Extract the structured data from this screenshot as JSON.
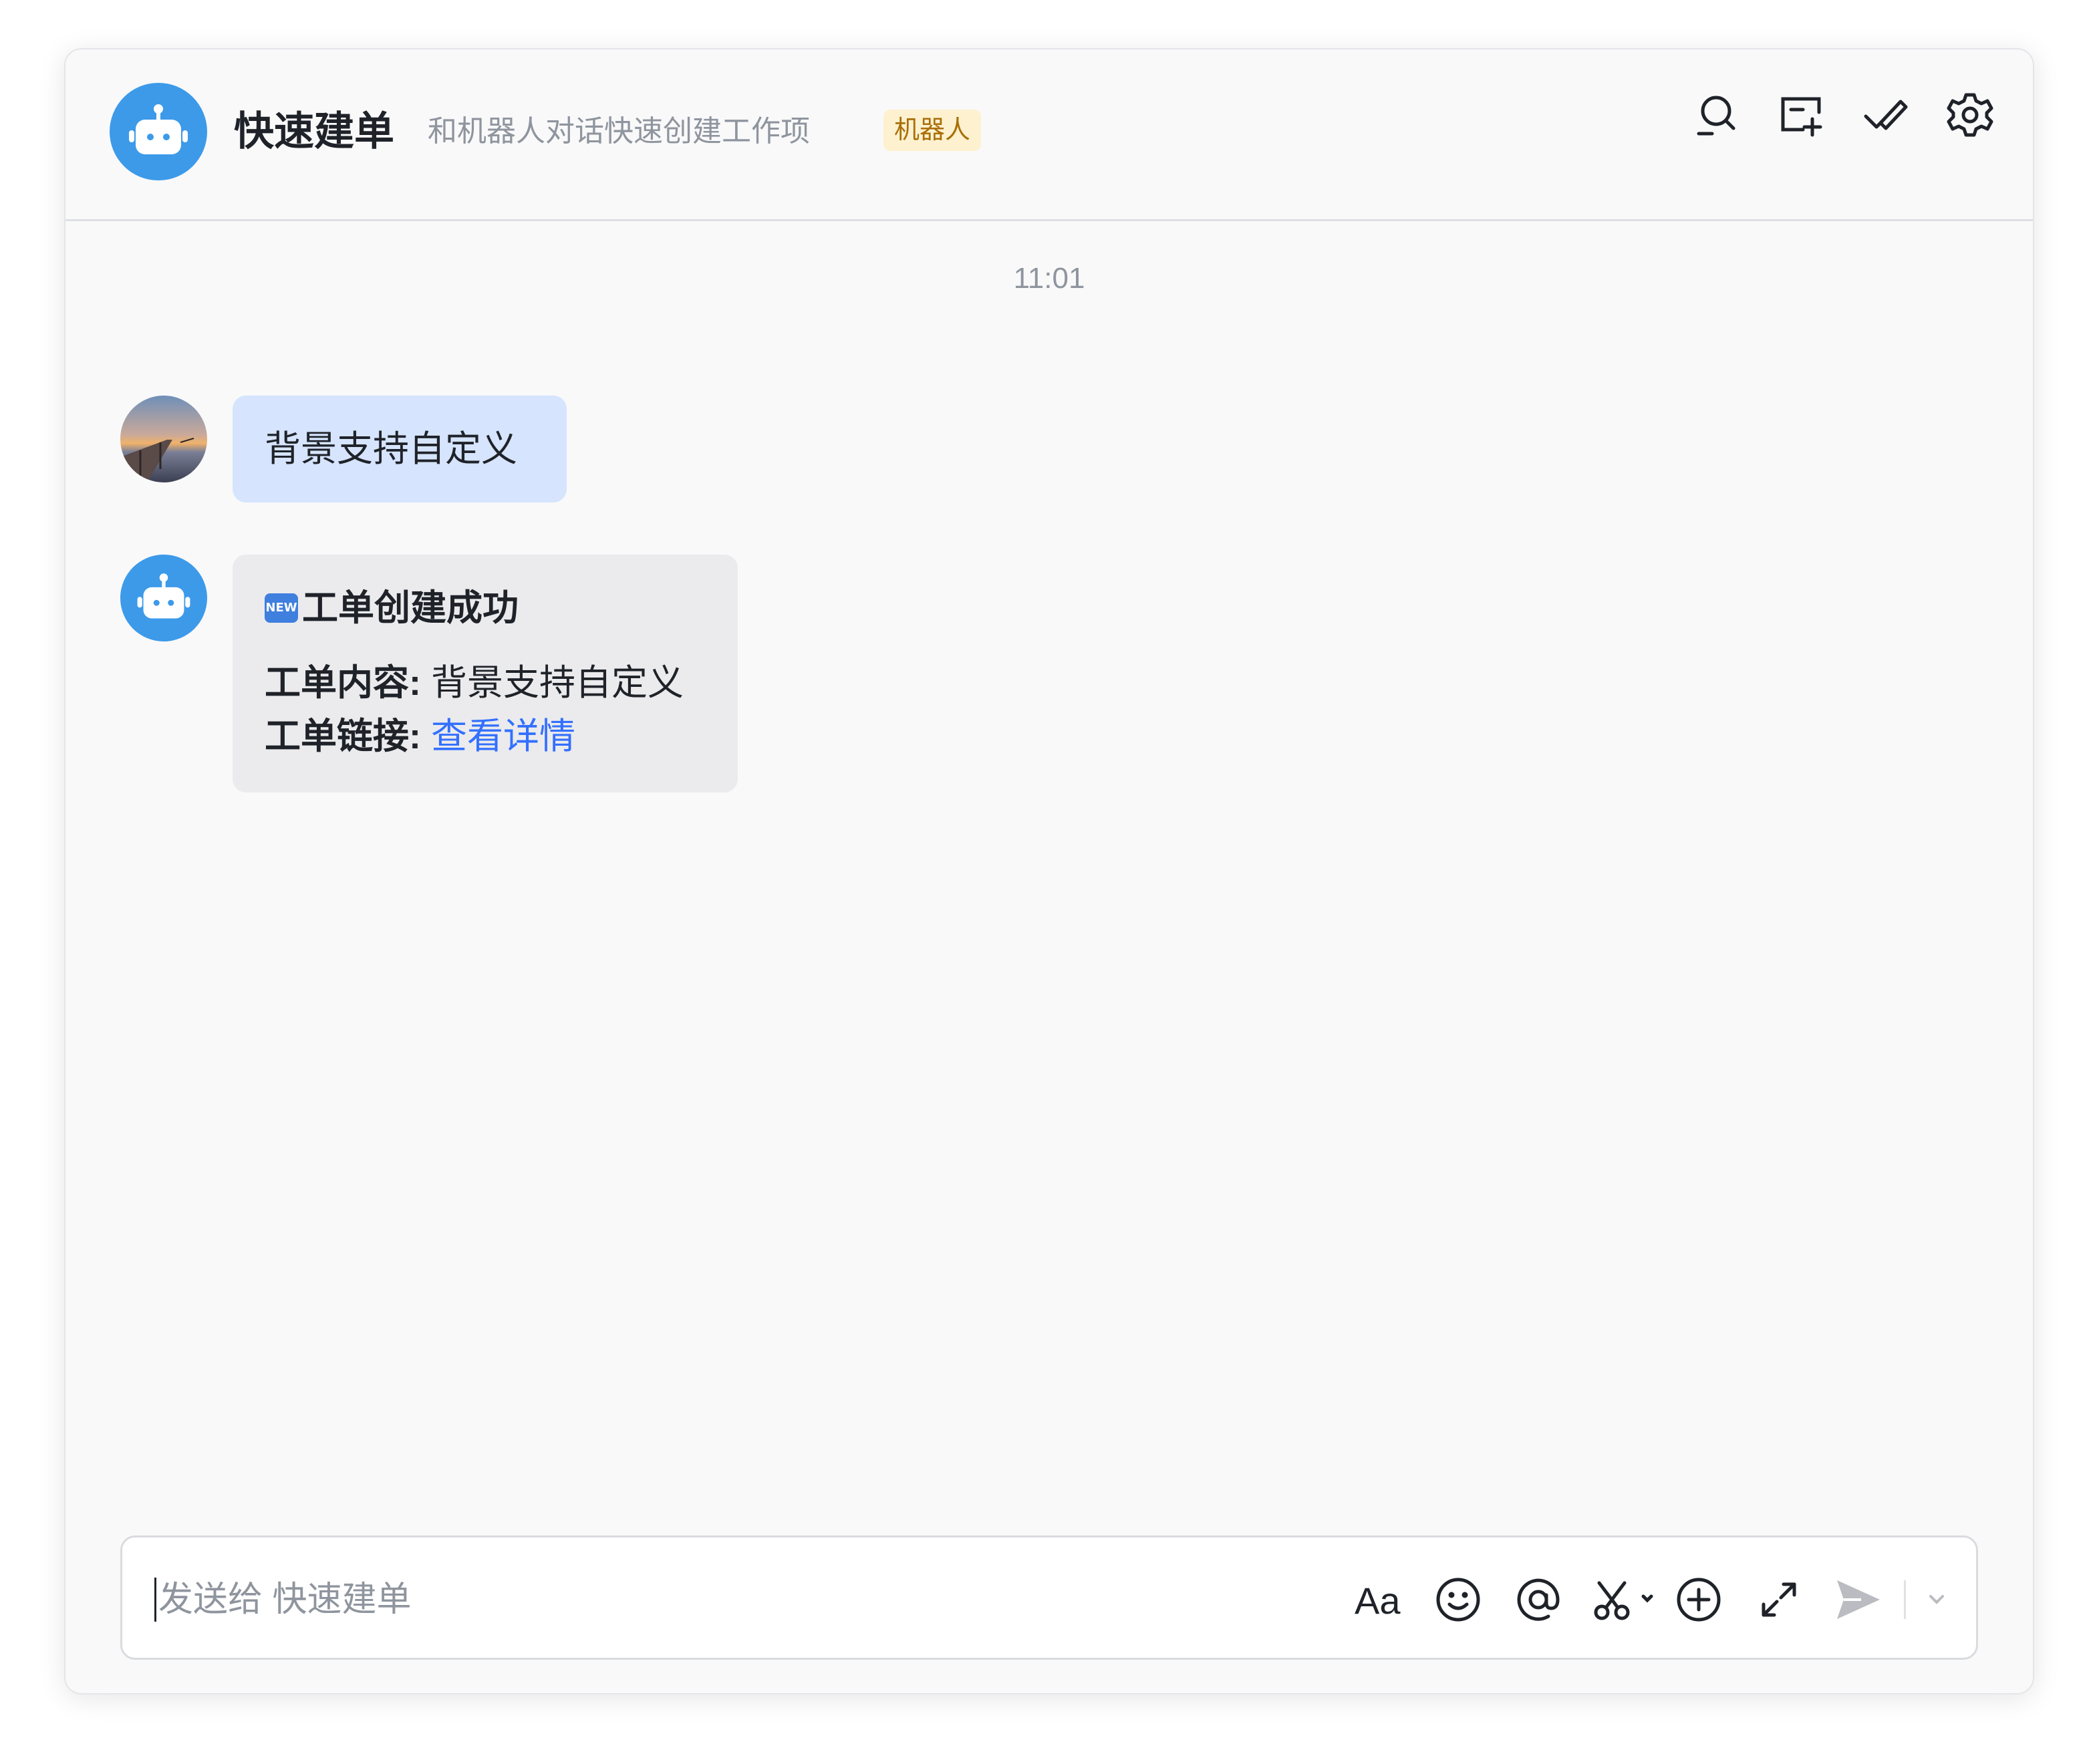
{
  "header": {
    "title": "快速建单",
    "subtitle": "和机器人对话快速创建工作项",
    "badge": "机器人",
    "icons": [
      "search-chat-icon",
      "new-window-icon",
      "check-pen-icon",
      "settings-gear-icon"
    ]
  },
  "chat": {
    "timestamp": "11:01",
    "messages": [
      {
        "sender": "user",
        "avatar": "sunset-pier-avatar",
        "text": "背景支持自定义"
      },
      {
        "sender": "bot",
        "avatar": "robot-avatar",
        "card": {
          "emoji_label": "NEW",
          "title": "工单创建成功",
          "content_label": "工单内容:",
          "content_value": "背景支持自定义",
          "link_label": "工单链接:",
          "link_text": "查看详情"
        }
      }
    ]
  },
  "composer": {
    "placeholder": "发送给 快速建单",
    "tools": [
      "text-format-icon",
      "emoji-icon",
      "mention-icon",
      "screenshot-scissors-icon",
      "add-circle-icon",
      "expand-icon",
      "send-icon",
      "send-options-chevron-icon"
    ],
    "text_format_label": "Aa"
  },
  "colors": {
    "accent": "#3370ff",
    "bot_avatar": "#3c9ae9",
    "user_bubble": "#d6e4fd",
    "bot_bubble": "#ebebed",
    "badge_bg": "#fdf1cf",
    "badge_text": "#a96f09"
  }
}
